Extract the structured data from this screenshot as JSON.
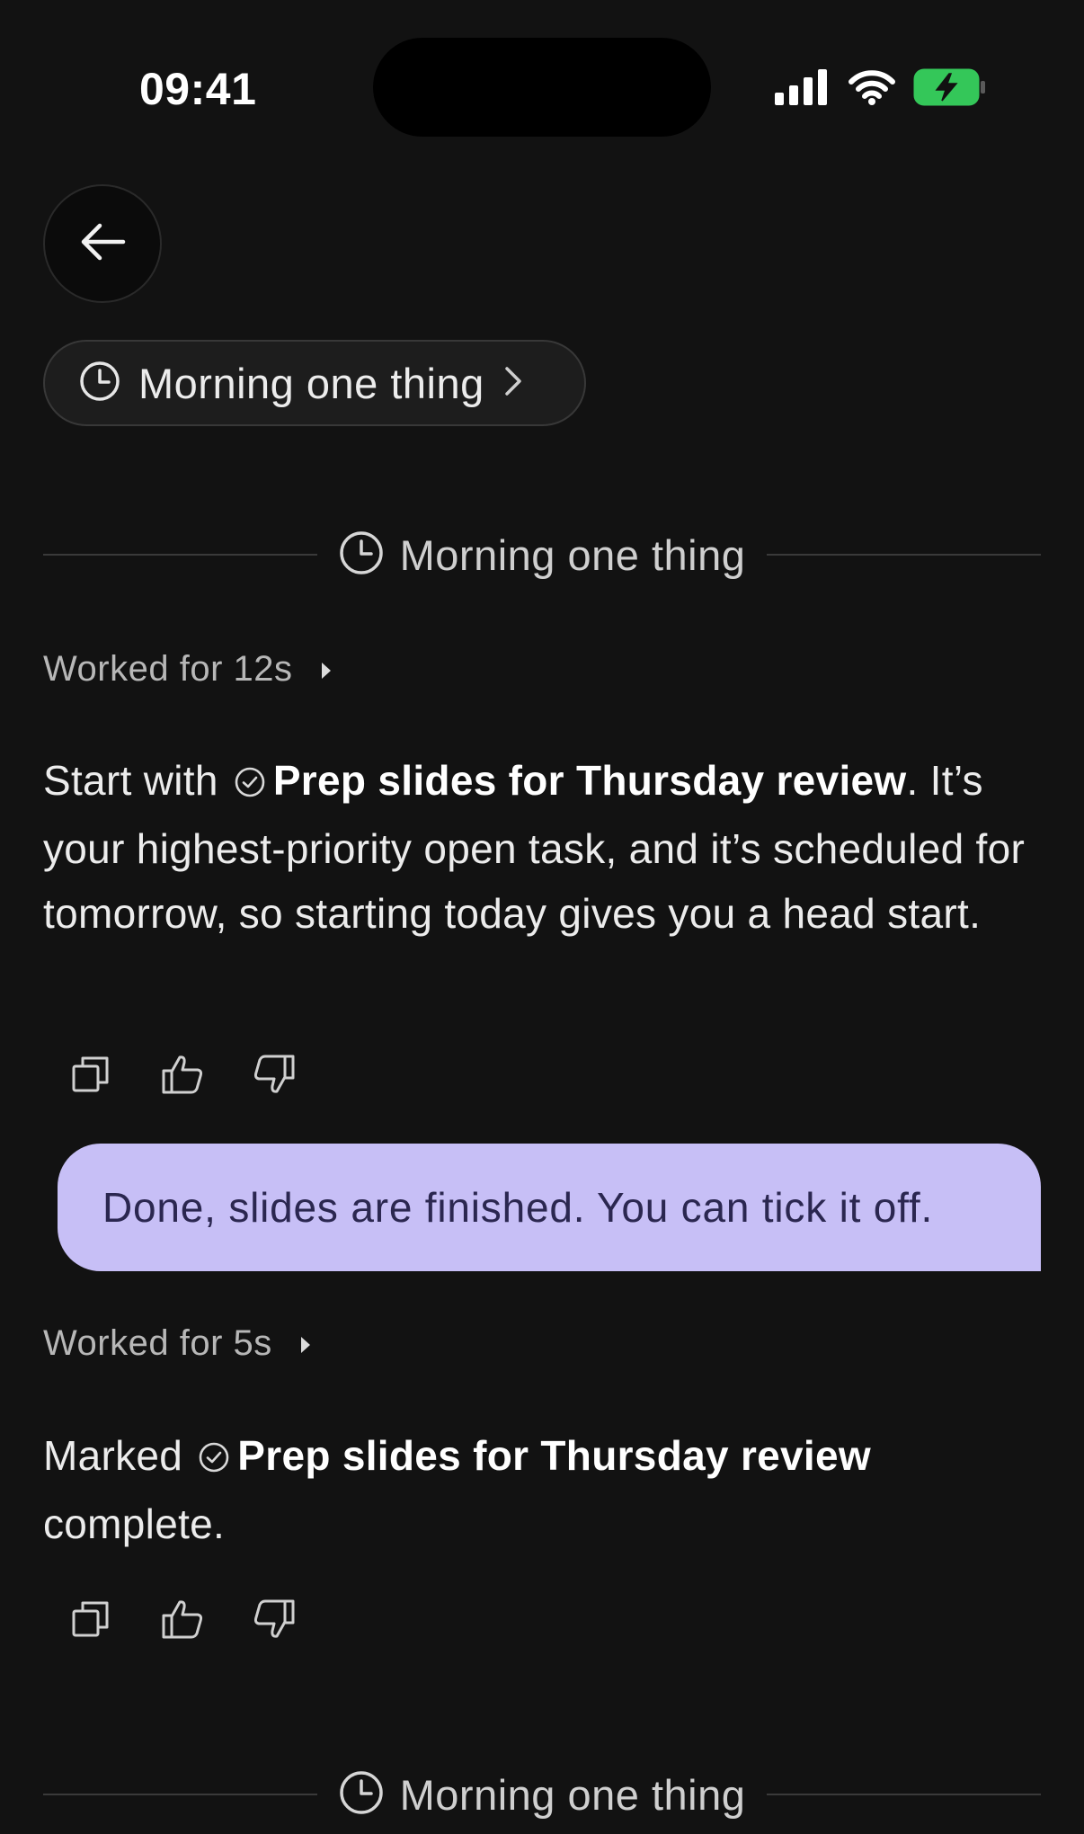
{
  "status_bar": {
    "time": "09:41"
  },
  "nav": {
    "back_icon": "arrow-left-icon"
  },
  "pill": {
    "label": "Morning one thing",
    "icon": "clock-icon"
  },
  "thread": {
    "divider_label": "Morning one thing",
    "first_reply": {
      "worked_label": "Worked for 12s",
      "intro": "Start with",
      "task_name": "Prep slides for Thursday review",
      "body": ". It’s your highest-priority open task, and it’s scheduled for tomorrow, so starting today gives you a head start."
    },
    "user_message": "Done, slides are finished. You can tick it off.",
    "second_reply": {
      "worked_label": "Worked for 5s",
      "intro": "Marked",
      "task_name": "Prep slides for Thursday review",
      "body": "complete."
    },
    "bottom_divider_label": "Morning one thing"
  },
  "colors": {
    "background": "#121212",
    "bubble": "#c7bff6",
    "bubble_text": "#2b2750",
    "battery_green": "#34c759"
  }
}
